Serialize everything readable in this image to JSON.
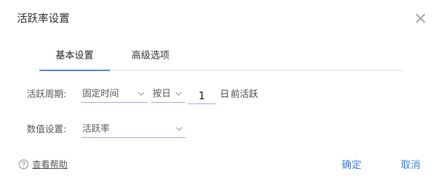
{
  "dialog": {
    "title": "活跃率设置",
    "close_icon": "close-icon"
  },
  "tabs": [
    {
      "label": "基本设置",
      "active": true
    },
    {
      "label": "高级选项",
      "active": false
    }
  ],
  "period": {
    "label": "活跃周期:",
    "type_select": "固定时间",
    "unit_select": "按日",
    "count": "1",
    "suffix_unit": "日",
    "suffix_text": "前活跃"
  },
  "metric": {
    "label": "数值设置:",
    "select": "活跃率"
  },
  "footer": {
    "help_icon": "question-circle-icon",
    "help_text": "查看帮助",
    "ok_label": "确定",
    "cancel_label": "取消"
  },
  "colors": {
    "accent": "#3b7ddd",
    "tab_indicator": "#4a7fd8",
    "underline": "#8fb1e8"
  }
}
